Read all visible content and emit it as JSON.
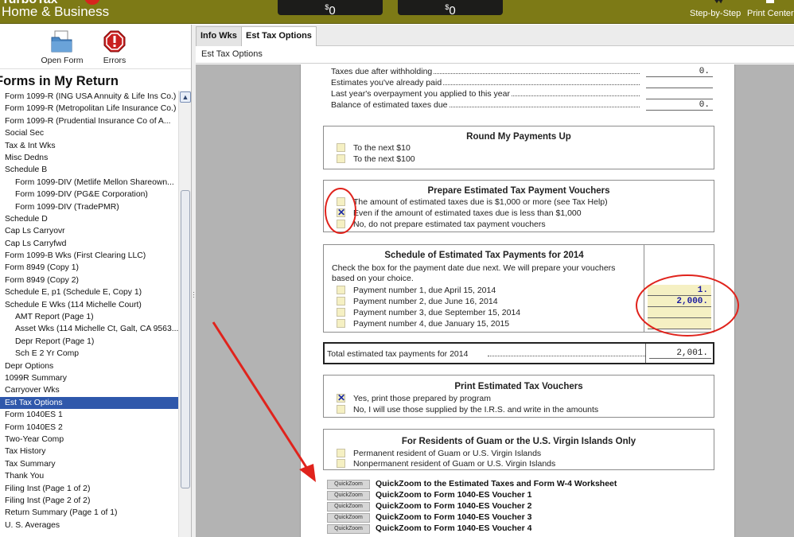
{
  "app": {
    "brand_line": "Home & Business",
    "brand_top": "TurboTax",
    "refund_federal": "0",
    "refund_state": "0",
    "refund_currency": "$",
    "step_by_step_label": "Step-by-Step",
    "print_center_label": "Print Center"
  },
  "toolbar": {
    "open_form_label": "Open Form",
    "errors_label": "Errors"
  },
  "left_panel": {
    "heading": "Forms in My Return",
    "items": [
      {
        "label": "Form 1099-R (ING USA Annuity & Life Ins Co.)",
        "indent": false
      },
      {
        "label": "Form 1099-R (Metropolitan Life Insurance Co.)",
        "indent": false
      },
      {
        "label": "Form 1099-R (Prudential Insurance Co of A...",
        "indent": false
      },
      {
        "label": "Social Sec",
        "indent": false
      },
      {
        "label": "Tax & Int Wks",
        "indent": false
      },
      {
        "label": "Misc Dedns",
        "indent": false
      },
      {
        "label": "Schedule B",
        "indent": false
      },
      {
        "label": "Form 1099-DIV (Metlife Mellon Shareown...",
        "indent": true
      },
      {
        "label": "Form 1099-DIV (PG&E Corporation)",
        "indent": true
      },
      {
        "label": "Form 1099-DIV (TradePMR)",
        "indent": true
      },
      {
        "label": "Schedule D",
        "indent": false
      },
      {
        "label": "Cap Ls Carryovr",
        "indent": false
      },
      {
        "label": "Cap Ls Carryfwd",
        "indent": false
      },
      {
        "label": "Form 1099-B Wks (First Clearing LLC)",
        "indent": false
      },
      {
        "label": "Form 8949 (Copy 1)",
        "indent": false
      },
      {
        "label": "Form 8949 (Copy 2)",
        "indent": false
      },
      {
        "label": "Schedule E, p1 (Schedule E, Copy 1)",
        "indent": false
      },
      {
        "label": "Schedule E Wks (114 Michelle Court)",
        "indent": false
      },
      {
        "label": "AMT Report (Page 1)",
        "indent": true
      },
      {
        "label": "Asset Wks (114 Michelle Ct, Galt, CA 9563...",
        "indent": true
      },
      {
        "label": "Depr Report (Page 1)",
        "indent": true
      },
      {
        "label": "Sch E 2 Yr Comp",
        "indent": true
      },
      {
        "label": "Depr Options",
        "indent": false
      },
      {
        "label": "1099R Summary",
        "indent": false
      },
      {
        "label": "Carryover Wks",
        "indent": false
      },
      {
        "label": "Est Tax Options",
        "indent": false,
        "selected": true
      },
      {
        "label": "Form 1040ES 1",
        "indent": false
      },
      {
        "label": "Form 1040ES 2",
        "indent": false
      },
      {
        "label": "Two-Year Comp",
        "indent": false
      },
      {
        "label": "Tax History",
        "indent": false
      },
      {
        "label": "Tax Summary",
        "indent": false
      },
      {
        "label": "Thank You",
        "indent": false
      },
      {
        "label": "Filing Inst (Page 1 of 2)",
        "indent": false
      },
      {
        "label": "Filing Inst (Page 2 of 2)",
        "indent": false
      },
      {
        "label": "Return Summary (Page 1 of 1)",
        "indent": false
      },
      {
        "label": "U. S. Averages",
        "indent": false
      }
    ]
  },
  "tabs": {
    "info_wks": "Info Wks",
    "est_tax_options": "Est Tax Options"
  },
  "breadcrumb": "Est Tax Options",
  "form": {
    "top_rows": [
      {
        "label": "Taxes due after withholding",
        "amount": "0."
      },
      {
        "label": "Estimates you've already paid",
        "amount": ""
      },
      {
        "label": "Last year's overpayment you applied to this year",
        "amount": ""
      },
      {
        "label": "Balance of estimated taxes due",
        "amount": "0."
      }
    ],
    "round_up": {
      "title": "Round My Payments Up",
      "options": [
        {
          "label": "To the next $10",
          "checked": false
        },
        {
          "label": "To the next $100",
          "checked": false
        }
      ]
    },
    "vouchers": {
      "title": "Prepare Estimated Tax Payment Vouchers",
      "options": [
        {
          "label": "The amount of estimated taxes due is $1,000 or more (see Tax Help)",
          "checked": false
        },
        {
          "label": "Even if the amount of estimated taxes due is less than $1,000",
          "checked": true
        },
        {
          "label": "No, do not prepare estimated tax payment vouchers",
          "checked": false
        }
      ]
    },
    "schedule": {
      "title": "Schedule of Estimated Tax Payments for 2014",
      "instructions_1": "Check the box for the payment date due next. We will prepare your vouchers",
      "instructions_2": "based on your choice.",
      "payments": [
        {
          "label": "Payment number 1, due April 15, 2014",
          "amount": "1."
        },
        {
          "label": "Payment number 2, due June 16, 2014",
          "amount": "2,000."
        },
        {
          "label": "Payment number 3, due September 15, 2014",
          "amount": ""
        },
        {
          "label": "Payment number 4, due January 15, 2015",
          "amount": ""
        }
      ]
    },
    "total": {
      "label": "Total estimated tax payments for 2014",
      "amount": "2,001."
    },
    "print_vouchers": {
      "title": "Print Estimated Tax Vouchers",
      "options": [
        {
          "label": "Yes, print those prepared by program",
          "checked": true
        },
        {
          "label": "No, I will use those supplied by the I.R.S. and write in the amounts",
          "checked": false
        }
      ]
    },
    "residents": {
      "title": "For Residents of Guam or the U.S. Virgin Islands Only",
      "options": [
        {
          "label": "Permanent resident of Guam or U.S. Virgin Islands",
          "checked": false
        },
        {
          "label": "Nonpermanent resident of Guam or U.S. Virgin Islands",
          "checked": false
        }
      ]
    },
    "quickzoom_button_label": "QuickZoom",
    "quickzooms": [
      "QuickZoom to the Estimated Taxes and Form W-4  Worksheet",
      "QuickZoom to Form 1040-ES Voucher 1",
      "QuickZoom to Form 1040-ES Voucher 2",
      "QuickZoom to Form 1040-ES Voucher 3",
      "QuickZoom to Form 1040-ES Voucher 4"
    ]
  },
  "colors": {
    "topbar": "#7d7a16",
    "selection": "#2f58ab",
    "entry_field": "#f5f0c3",
    "annotation_red": "#e0231c",
    "check_mark": "#1b2aa6"
  }
}
